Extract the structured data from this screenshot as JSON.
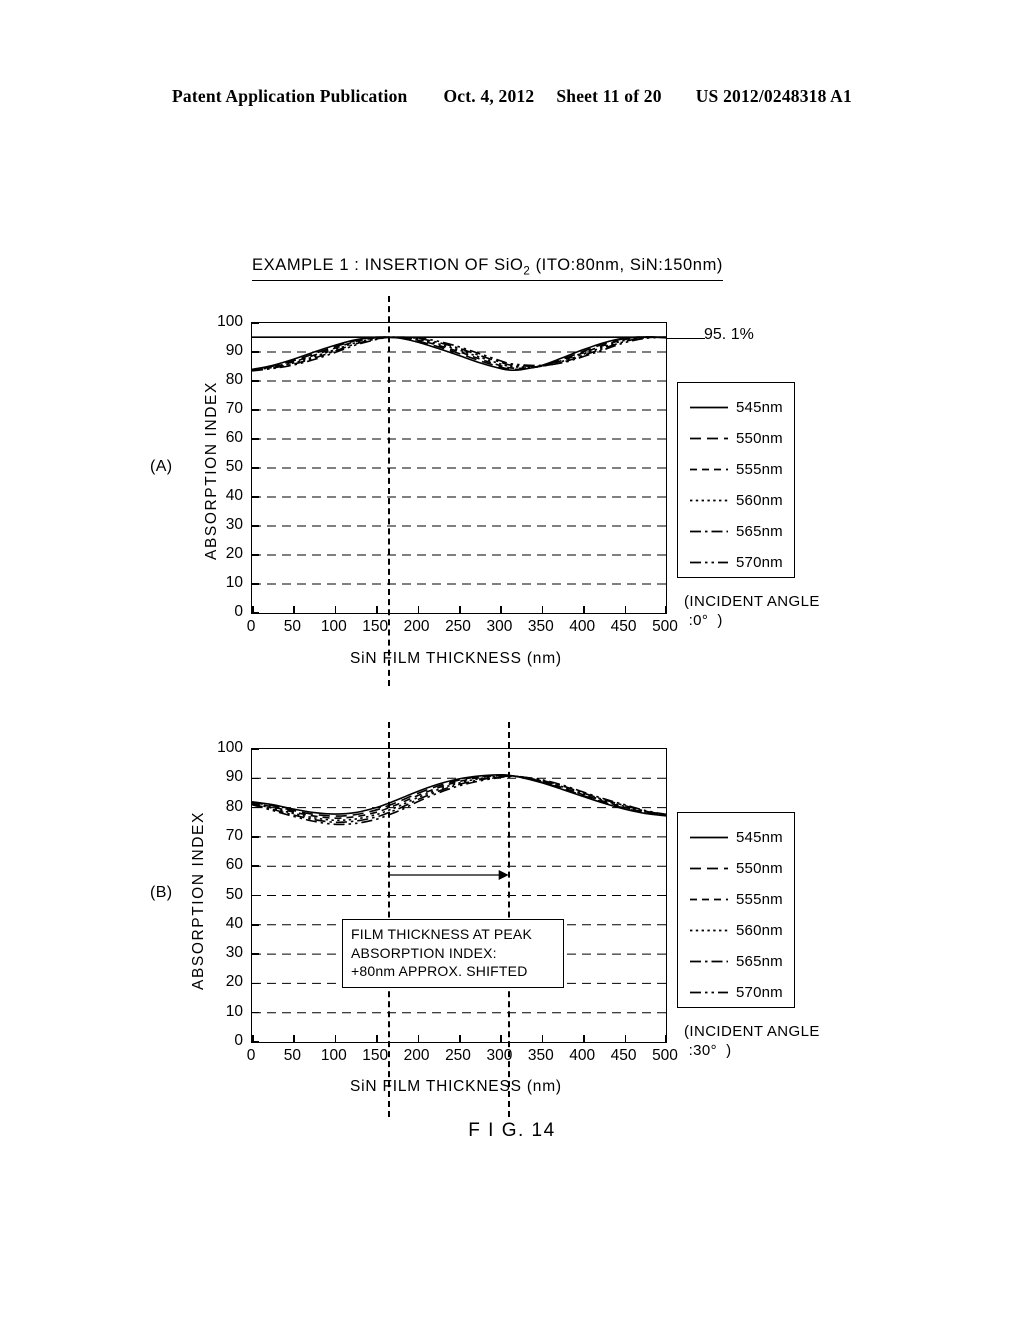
{
  "header": {
    "publication": "Patent Application Publication",
    "date": "Oct. 4, 2012",
    "sheet": "Sheet 11 of 20",
    "number": "US 2012/0248318 A1"
  },
  "figure": {
    "caption": "F I G. 14",
    "title_main": "EXAMPLE 1 : INSERTION OF SiO",
    "title_sub": "2",
    "title_tail": " (ITO:80nm, SiN:150nm)"
  },
  "panels": [
    {
      "label": "(A)",
      "incident_angle": "(INCIDENT ANGLE\n :0°  )",
      "callout": "95. 1%",
      "xlabel": "SiN FILM THICKNESS (nm)",
      "ylabel": "ABSORPTION INDEX"
    },
    {
      "label": "(B)",
      "incident_angle": "(INCIDENT ANGLE\n :30°  )",
      "xlabel": "SiN FILM THICKNESS (nm)",
      "ylabel": "ABSORPTION INDEX",
      "annotation": "FILM THICKNESS AT PEAK\nABSORPTION INDEX:\n+80nm APPROX. SHIFTED"
    }
  ],
  "legend": {
    "entries": [
      {
        "label": "545nm",
        "style": "solid"
      },
      {
        "label": "550nm",
        "style": "dashed"
      },
      {
        "label": "555nm",
        "style": "dashed-fine"
      },
      {
        "label": "560nm",
        "style": "dotted"
      },
      {
        "label": "565nm",
        "style": "dash-dot"
      },
      {
        "label": "570nm",
        "style": "dash-dot-dot"
      }
    ]
  },
  "chart_data": [
    {
      "type": "line",
      "panel": "(A)",
      "title": "EXAMPLE 1 : INSERTION OF SiO2 (ITO:80nm, SiN:150nm)",
      "xlabel": "SiN FILM THICKNESS (nm)",
      "ylabel": "ABSORPTION INDEX",
      "xlim": [
        0,
        500
      ],
      "ylim": [
        0,
        100
      ],
      "xticks": [
        0,
        50,
        100,
        150,
        200,
        250,
        300,
        350,
        400,
        450,
        500
      ],
      "yticks": [
        0,
        10,
        20,
        30,
        40,
        50,
        60,
        70,
        80,
        90,
        100
      ],
      "grid": true,
      "legend_position": "right",
      "annotations": [
        {
          "text": "95. 1%",
          "type": "leader-line",
          "y": 95.1
        },
        {
          "text": "",
          "type": "vline",
          "x": 165
        }
      ],
      "x": [
        0,
        25,
        50,
        75,
        100,
        125,
        150,
        165,
        180,
        200,
        225,
        250,
        275,
        300,
        310,
        325,
        350,
        375,
        400,
        425,
        450,
        475,
        500
      ],
      "series": [
        {
          "name": "545nm",
          "values": [
            84.0,
            85.4,
            87.5,
            90.0,
            92.3,
            94.2,
            95.1,
            95.1,
            94.7,
            93.4,
            91.2,
            88.8,
            86.3,
            84.3,
            83.8,
            83.9,
            85.4,
            88.0,
            90.8,
            93.2,
            94.8,
            95.2,
            94.9
          ]
        },
        {
          "name": "550nm",
          "values": [
            83.9,
            85.1,
            87.0,
            89.4,
            91.8,
            93.9,
            95.0,
            95.1,
            94.8,
            93.8,
            91.8,
            89.5,
            87.0,
            84.8,
            84.2,
            84.1,
            85.2,
            87.5,
            90.2,
            92.8,
            94.6,
            95.2,
            95.0
          ]
        },
        {
          "name": "555nm",
          "values": [
            83.8,
            84.9,
            86.6,
            88.9,
            91.3,
            93.6,
            94.9,
            95.1,
            94.9,
            94.1,
            92.3,
            90.1,
            87.6,
            85.3,
            84.6,
            84.4,
            85.1,
            87.1,
            89.7,
            92.3,
            94.3,
            95.1,
            95.1
          ]
        },
        {
          "name": "560nm",
          "values": [
            83.7,
            84.7,
            86.2,
            88.4,
            90.8,
            93.2,
            94.7,
            95.1,
            95.0,
            94.4,
            92.8,
            90.7,
            88.2,
            85.9,
            85.1,
            84.8,
            85.1,
            86.8,
            89.2,
            91.8,
            94.0,
            95.0,
            95.1
          ]
        },
        {
          "name": "565nm",
          "values": [
            83.6,
            84.5,
            85.8,
            87.9,
            90.3,
            92.8,
            94.5,
            95.0,
            95.1,
            94.7,
            93.3,
            91.3,
            88.8,
            86.5,
            85.6,
            85.2,
            85.2,
            86.5,
            88.8,
            91.3,
            93.6,
            94.9,
            95.1
          ]
        },
        {
          "name": "570nm",
          "values": [
            83.5,
            84.3,
            85.5,
            87.4,
            89.8,
            92.4,
            94.3,
            95.0,
            95.1,
            94.9,
            93.7,
            91.8,
            89.4,
            87.0,
            86.1,
            85.6,
            85.4,
            86.3,
            88.4,
            90.8,
            93.2,
            94.7,
            95.1
          ]
        }
      ]
    },
    {
      "type": "line",
      "panel": "(B)",
      "xlabel": "SiN FILM THICKNESS (nm)",
      "ylabel": "ABSORPTION INDEX",
      "xlim": [
        0,
        500
      ],
      "ylim": [
        0,
        100
      ],
      "xticks": [
        0,
        50,
        100,
        150,
        200,
        250,
        300,
        350,
        400,
        450,
        500
      ],
      "yticks": [
        0,
        10,
        20,
        30,
        40,
        50,
        60,
        70,
        80,
        90,
        100
      ],
      "grid": true,
      "legend_position": "right",
      "annotations": [
        {
          "text": "",
          "type": "vline",
          "x": 165
        },
        {
          "text": "",
          "type": "vline",
          "x": 310
        },
        {
          "text": "FILM THICKNESS AT PEAK ABSORPTION INDEX: +80nm APPROX. SHIFTED",
          "type": "box"
        },
        {
          "text": "",
          "type": "arrow",
          "x0": 165,
          "x1": 310,
          "y": 57
        }
      ],
      "x": [
        0,
        25,
        50,
        75,
        100,
        125,
        150,
        165,
        180,
        200,
        225,
        250,
        275,
        300,
        310,
        325,
        350,
        375,
        400,
        425,
        450,
        475,
        500
      ],
      "series": [
        {
          "name": "545nm",
          "values": [
            82.0,
            81.0,
            79.5,
            78.3,
            77.8,
            78.3,
            80.0,
            81.5,
            83.2,
            85.5,
            88.0,
            89.8,
            90.8,
            91.2,
            91.0,
            90.3,
            88.5,
            86.2,
            83.8,
            81.5,
            79.5,
            78.0,
            77.2
          ]
        },
        {
          "name": "550nm",
          "values": [
            81.8,
            80.6,
            79.0,
            77.7,
            77.1,
            77.6,
            79.2,
            80.7,
            82.4,
            84.8,
            87.4,
            89.4,
            90.6,
            91.1,
            91.0,
            90.4,
            88.7,
            86.5,
            84.1,
            81.8,
            79.8,
            78.2,
            77.3
          ]
        },
        {
          "name": "555nm",
          "values": [
            81.6,
            80.2,
            78.5,
            77.1,
            76.4,
            76.9,
            78.4,
            79.9,
            81.6,
            84.1,
            86.8,
            88.9,
            90.3,
            90.9,
            90.9,
            90.5,
            88.9,
            86.8,
            84.4,
            82.1,
            80.1,
            78.4,
            77.4
          ]
        },
        {
          "name": "560nm",
          "values": [
            81.4,
            79.8,
            78.0,
            76.5,
            75.7,
            76.1,
            77.6,
            79.1,
            80.8,
            83.4,
            86.2,
            88.4,
            89.9,
            90.7,
            90.8,
            90.5,
            89.1,
            87.1,
            84.7,
            82.4,
            80.4,
            78.6,
            77.5
          ]
        },
        {
          "name": "565nm",
          "values": [
            81.2,
            79.4,
            77.5,
            75.9,
            75.0,
            75.4,
            76.8,
            78.3,
            80.0,
            82.7,
            85.6,
            87.9,
            89.5,
            90.5,
            90.7,
            90.5,
            89.3,
            87.4,
            85.0,
            82.7,
            80.7,
            78.8,
            77.6
          ]
        },
        {
          "name": "570nm",
          "values": [
            81.0,
            79.0,
            77.0,
            75.3,
            74.3,
            74.6,
            76.0,
            77.5,
            79.2,
            82.0,
            85.0,
            87.4,
            89.1,
            90.3,
            90.6,
            90.5,
            89.5,
            87.7,
            85.3,
            83.0,
            81.0,
            79.0,
            77.7
          ]
        }
      ]
    }
  ]
}
